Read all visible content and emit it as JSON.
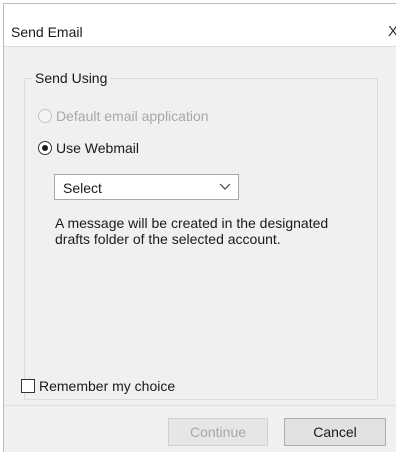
{
  "window": {
    "title": "Send Email",
    "close_glyph": "X"
  },
  "group": {
    "legend": "Send Using",
    "options": [
      {
        "label": "Default email application",
        "selected": false,
        "enabled": false
      },
      {
        "label": "Use Webmail",
        "selected": true,
        "enabled": true
      }
    ],
    "webmail_select": {
      "value": "Select",
      "icon": "chevron-down-icon"
    },
    "info_text": "A message will be created in the designated drafts folder of the selected account."
  },
  "remember": {
    "label": "Remember my choice",
    "checked": false
  },
  "buttons": {
    "continue_label": "Continue",
    "cancel_label": "Cancel"
  }
}
